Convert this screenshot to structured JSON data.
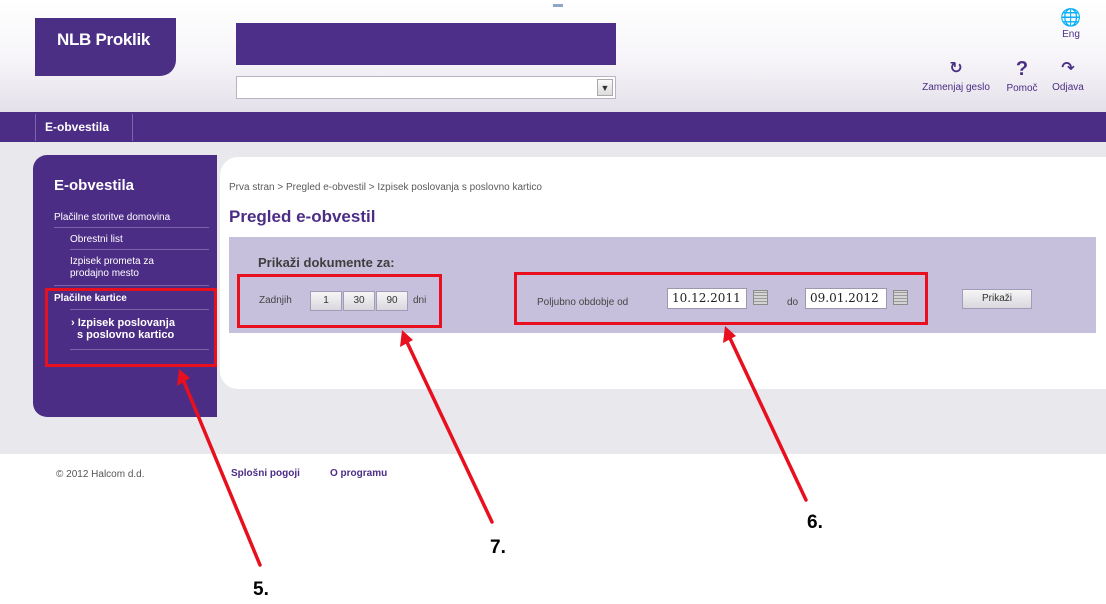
{
  "header": {
    "logo_text": "NLB Proklik",
    "language": "Eng",
    "change_password": "Zamenjaj geslo",
    "help": "Pomoč",
    "logout": "Odjava",
    "account_select_value": ""
  },
  "nav": {
    "active_tab": "E-obvestila"
  },
  "sidebar": {
    "title": "E-obvestila",
    "section1": "Plačilne storitve domovina",
    "item_interest": "Obrestni list",
    "item_turnover_line1": "Izpisek prometa za",
    "item_turnover_line2": "prodajno mesto",
    "section2": "Plačilne kartice",
    "active_arrow": "›",
    "active_item_line1": "Izpisek poslovanja",
    "active_item_line2": "s poslovno kartico"
  },
  "main": {
    "breadcrumb": "Prva stran > Pregled e-obvestil > Izpisek poslovanja s poslovno kartico",
    "title": "Pregled e-obvestil",
    "filter_heading": "Prikaži dokumente za:",
    "last_label": "Zadnjih",
    "day_buttons": [
      "1",
      "30",
      "90"
    ],
    "days_unit": "dni",
    "period_label": "Poljubno obdobje od",
    "date_from": "10.12.2011",
    "to_label": "do",
    "date_to": "09.01.2012",
    "show_button": "Prikaži"
  },
  "footer": {
    "copyright": "© 2012 Halcom d.d.",
    "terms_link": "Splošni pogoji",
    "about_link": "O programu"
  },
  "annotations": {
    "label5": "5.",
    "label6": "6.",
    "label7": "7."
  },
  "colors": {
    "brand": "#4c2d86",
    "panel": "#c7c0dd",
    "annotation": "#e8101e"
  }
}
